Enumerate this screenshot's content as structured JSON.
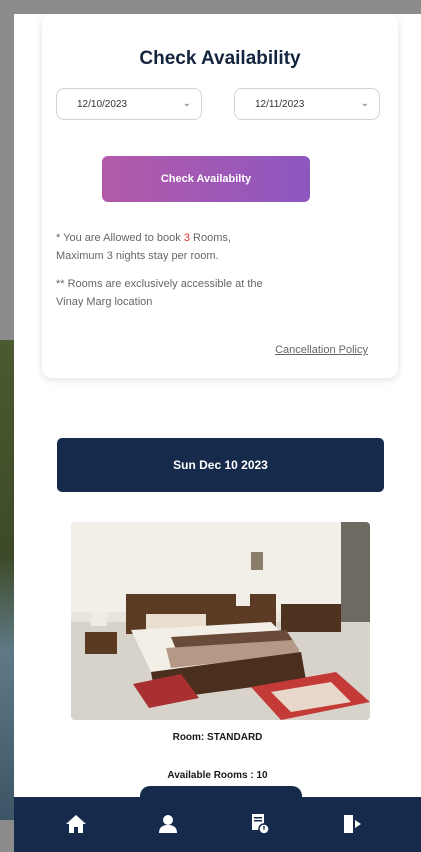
{
  "availability": {
    "title": "Check Availability",
    "from_date": "12/10/2023",
    "to_date": "12/11/2023",
    "check_button": "Check Availabilty"
  },
  "notes": {
    "line1_prefix": "* You are Allowed to book ",
    "line1_count": "3",
    "line1_suffix": " Rooms,",
    "line2": "Maximum 3 nights stay per room.",
    "line3": "** Rooms are exclusively accessible at the",
    "line4": "Vinay Marg location"
  },
  "cancellation_policy": "Cancellation Policy",
  "selected_day": "Sun Dec 10 2023",
  "room": {
    "type_label": "Room: STANDARD",
    "available_label": "Available Rooms : 10"
  },
  "nav": {
    "items": [
      {
        "icon": "home-icon"
      },
      {
        "icon": "user-icon"
      },
      {
        "icon": "bookings-icon"
      },
      {
        "icon": "logout-icon"
      }
    ]
  },
  "colors": {
    "navy": "#162b4b",
    "button_gradient_start": "#b25aa9",
    "button_gradient_end": "#8e57c0",
    "highlight_red": "#e0312f"
  }
}
